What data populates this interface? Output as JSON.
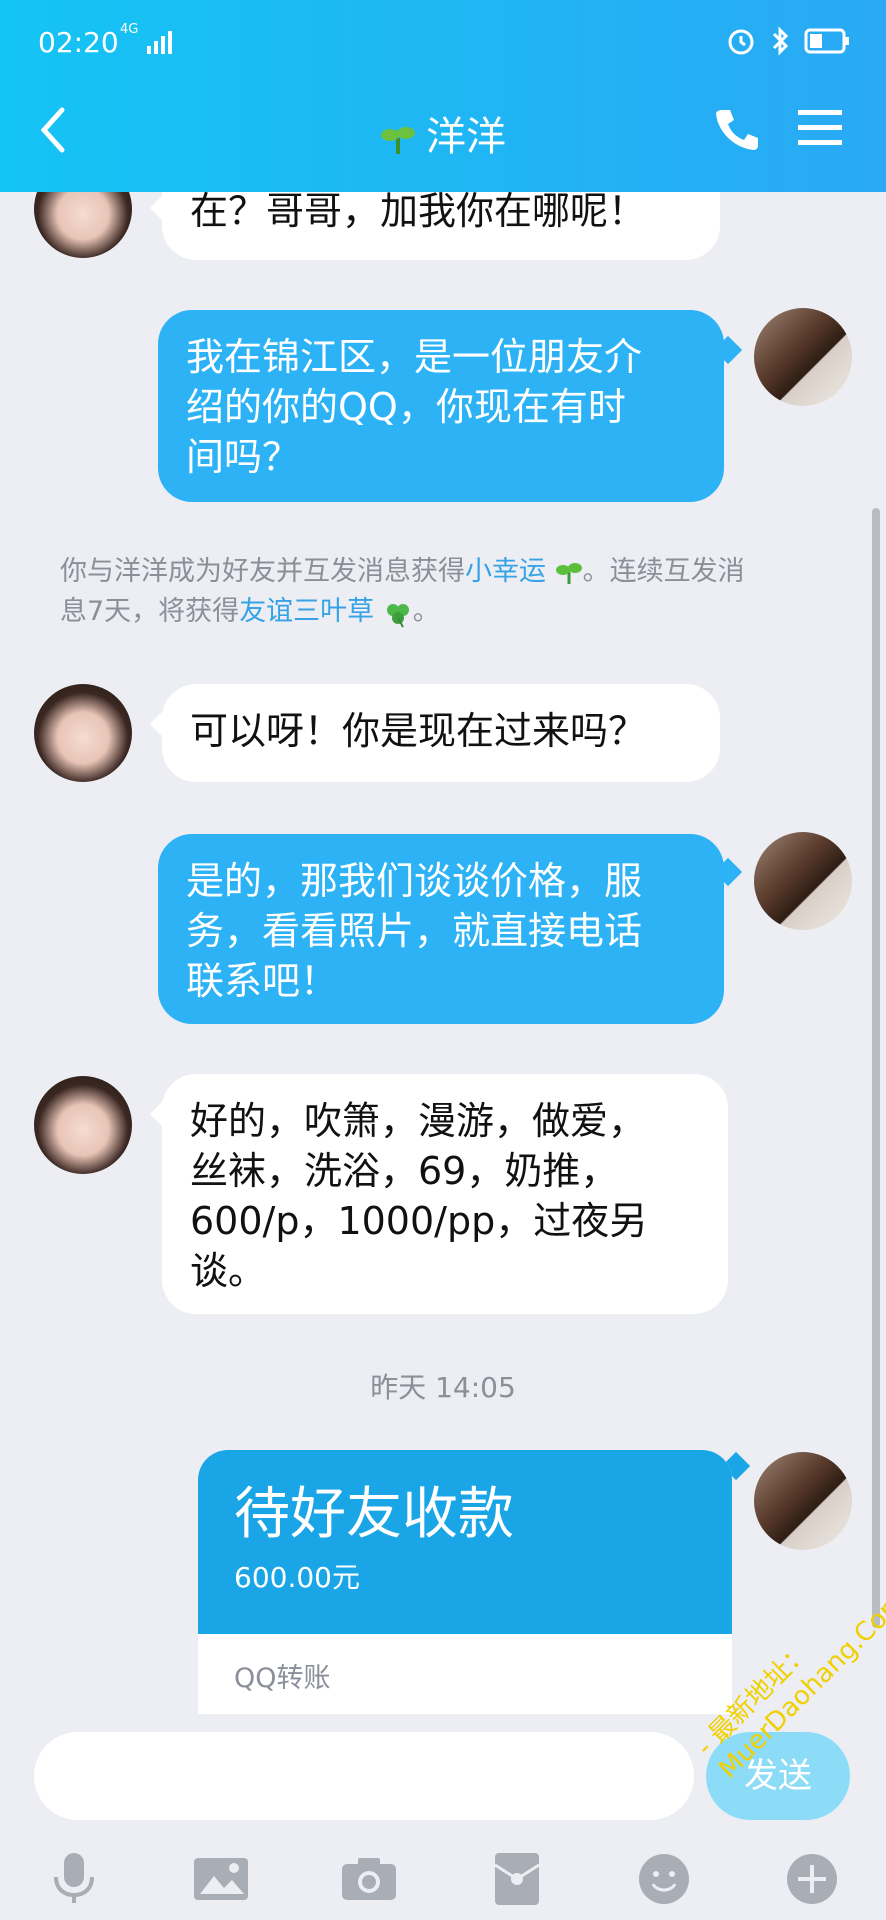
{
  "status": {
    "time": "02:20",
    "network": "4G"
  },
  "header": {
    "title": "洋洋",
    "icons": [
      "back-icon",
      "sprout-icon",
      "phone-icon",
      "menu-icon"
    ]
  },
  "messages": [
    {
      "from": "friend",
      "text": "在？哥哥，加我你在哪呢！"
    },
    {
      "from": "me",
      "lines": [
        "我在锦江区，是一位朋友介",
        "绍的你的QQ，你现在有时",
        "间吗？"
      ]
    },
    {
      "from": "friend",
      "text": "可以呀！你是现在过来吗？"
    },
    {
      "from": "me",
      "lines": [
        "是的，那我们谈谈价格，服",
        "务，看看照片，就直接电话",
        "联系吧！"
      ]
    },
    {
      "from": "friend",
      "lines": [
        "好的，吹箫，漫游，做爱，",
        "丝袜，洗浴，69，奶推，",
        "600/p，1000/pp，过夜另",
        "谈。"
      ]
    }
  ],
  "system": {
    "part1": "你与洋洋成为好友并互发消息获得",
    "link1": "小幸运",
    "part2": "。连续互发消",
    "part3": "息7天，将获得",
    "link2": "友谊三叶草",
    "part4": "。"
  },
  "timestamp": "昨天 14:05",
  "transfer": {
    "title": "待好友收款",
    "amount": "600.00元",
    "footer": "QQ转账"
  },
  "input": {
    "value": "",
    "send_label": "发送"
  },
  "toolbar": [
    "mic-icon",
    "image-icon",
    "camera-icon",
    "red-packet-icon",
    "emoji-icon",
    "plus-icon"
  ],
  "watermark": {
    "line1": "- 最新地址：",
    "line2": "MuerDaohang.Com"
  },
  "colors": {
    "header": "#1fb8f5",
    "outgoing": "#2db3f5",
    "incoming": "#ffffff",
    "link": "#35a3e6",
    "transfer": "#1aa6e6"
  }
}
